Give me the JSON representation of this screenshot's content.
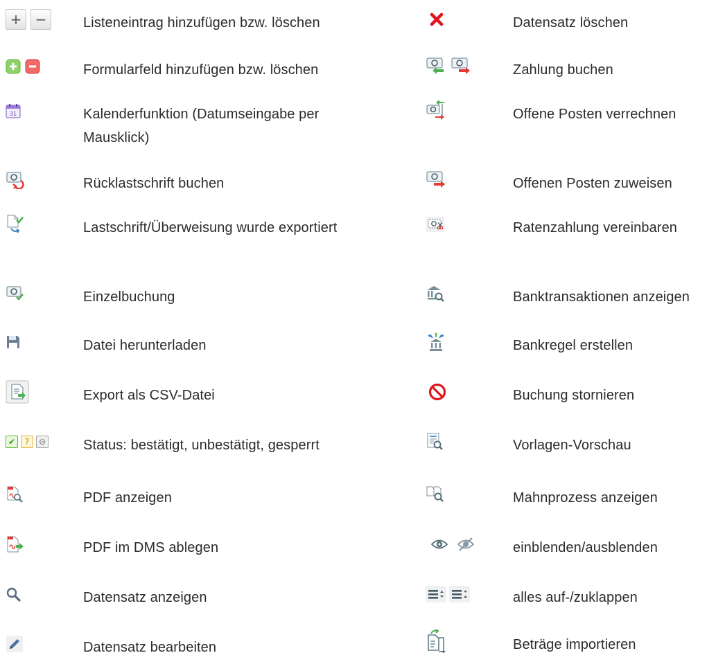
{
  "left_entries": [
    {
      "id": "list-add-remove",
      "label": "Listeneintrag hinzufügen bzw. löschen",
      "icons": [
        "plus-button-icon",
        "minus-button-icon"
      ]
    },
    {
      "id": "form-field-add-remove",
      "label": "Formularfeld hinzufügen bzw. löschen",
      "icons": [
        "green-plus-icon",
        "red-minus-icon"
      ]
    },
    {
      "id": "calendar",
      "label": "Kalenderfunktion (Datumseingabe per Mausklick)",
      "icons": [
        "calendar-icon"
      ],
      "calendar_day": "31"
    },
    {
      "id": "return-debit",
      "label": "Rücklastschrift buchen",
      "icons": [
        "return-debit-icon"
      ]
    },
    {
      "id": "debit-exported",
      "label": "Lastschrift/Überweisung wurde exportiert",
      "icons": [
        "document-exported-icon"
      ]
    },
    {
      "id": "single-booking",
      "label": "Einzelbuchung",
      "icons": [
        "money-check-icon"
      ]
    },
    {
      "id": "file-download",
      "label": "Datei herunterladen",
      "icons": [
        "floppy-disk-icon"
      ]
    },
    {
      "id": "csv-export",
      "label": "Export als CSV-Datei",
      "icons": [
        "csv-export-icon"
      ]
    },
    {
      "id": "status",
      "label": "Status: bestätigt, unbestätigt, gesperrt",
      "icons": [
        "status-confirmed-icon",
        "status-unconfirmed-icon",
        "status-locked-icon"
      ],
      "unconfirmed_glyph": "?"
    },
    {
      "id": "pdf-view",
      "label": "PDF anzeigen",
      "icons": [
        "pdf-search-icon"
      ]
    },
    {
      "id": "pdf-dms",
      "label": "PDF im DMS ablegen",
      "icons": [
        "pdf-export-icon"
      ]
    },
    {
      "id": "record-view",
      "label": "Datensatz anzeigen",
      "icons": [
        "magnifier-icon"
      ]
    },
    {
      "id": "record-edit",
      "label": "Datensatz bearbeiten",
      "icons": [
        "pencil-icon"
      ]
    }
  ],
  "right_entries": [
    {
      "id": "record-delete",
      "label": "Datensatz löschen",
      "icons": [
        "red-x-icon"
      ]
    },
    {
      "id": "payment-book",
      "label": "Zahlung buchen",
      "icons": [
        "money-in-icon",
        "money-out-icon"
      ]
    },
    {
      "id": "open-items-offset",
      "label": "Offene Posten verrechnen",
      "icons": [
        "money-offset-icon"
      ]
    },
    {
      "id": "open-item-assign",
      "label": "Offenen Posten zuweisen",
      "icons": [
        "money-assign-icon"
      ]
    },
    {
      "id": "installment",
      "label": "Ratenzahlung vereinbaren",
      "icons": [
        "money-scissors-icon"
      ]
    },
    {
      "id": "bank-transactions",
      "label": "Banktransaktionen anzeigen",
      "icons": [
        "bank-search-icon"
      ]
    },
    {
      "id": "bank-rule",
      "label": "Bankregel erstellen",
      "icons": [
        "bank-rule-icon"
      ]
    },
    {
      "id": "booking-cancel",
      "label": "Buchung stornieren",
      "icons": [
        "prohibited-icon"
      ]
    },
    {
      "id": "template-preview",
      "label": "Vorlagen-Vorschau",
      "icons": [
        "template-preview-icon"
      ]
    },
    {
      "id": "dunning-process",
      "label": "Mahnprozess anzeigen",
      "icons": [
        "documents-search-icon"
      ]
    },
    {
      "id": "show-hide",
      "label": "einblenden/ausblenden",
      "icons": [
        "eye-icon",
        "eye-slash-icon"
      ]
    },
    {
      "id": "expand-collapse",
      "label": "alles auf-/zuklappen",
      "icons": [
        "expand-all-icon",
        "collapse-all-icon"
      ]
    },
    {
      "id": "amounts-import",
      "label": "Beträge importieren",
      "icons": [
        "import-document-icon"
      ]
    }
  ],
  "colors": {
    "text": "#2b2b2b",
    "green": "#5cb82e",
    "red": "#e53935",
    "blue": "#3b7dc7",
    "purple": "#7e57c2"
  }
}
